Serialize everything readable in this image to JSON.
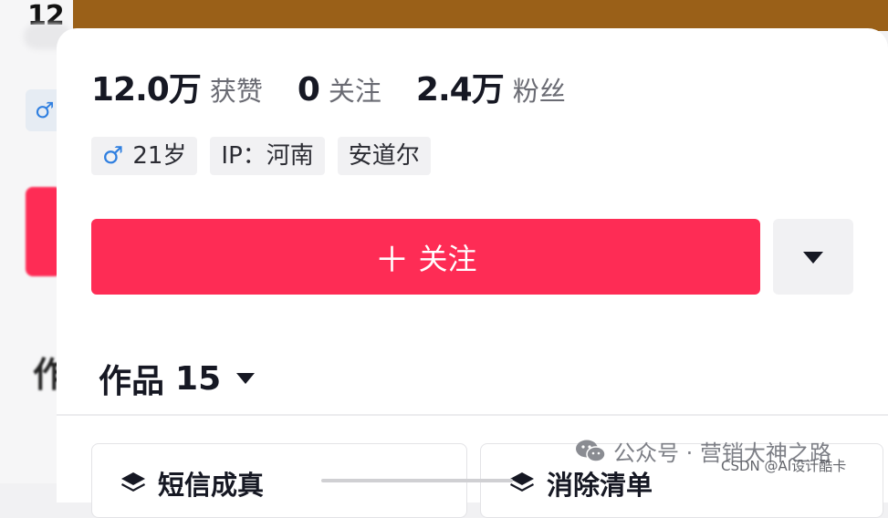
{
  "backdrop": {
    "partial_number": "12",
    "partial_heading": "作"
  },
  "stats": [
    {
      "value": "12.0万",
      "label": "获赞"
    },
    {
      "value": "0",
      "label": "关注"
    },
    {
      "value": "2.4万",
      "label": "粉丝"
    }
  ],
  "tags": {
    "gender_icon": "male-icon",
    "age": "21岁",
    "ip": "IP：河南",
    "location": "安道尔"
  },
  "follow_button": {
    "plus": "＋",
    "label": "关注"
  },
  "works": {
    "label": "作品",
    "count": "15"
  },
  "work_cards": [
    {
      "icon": "layers-icon",
      "title": "短信成真"
    },
    {
      "icon": "layers-icon",
      "title": "消除清单"
    }
  ],
  "watermark": {
    "text": "公众号 · 营销大神之路",
    "csdn": "CSDN @AI设计酷卡"
  },
  "colors": {
    "accent": "#fe2c55",
    "top_band": "#9a6018",
    "male": "#2f7fe0"
  }
}
